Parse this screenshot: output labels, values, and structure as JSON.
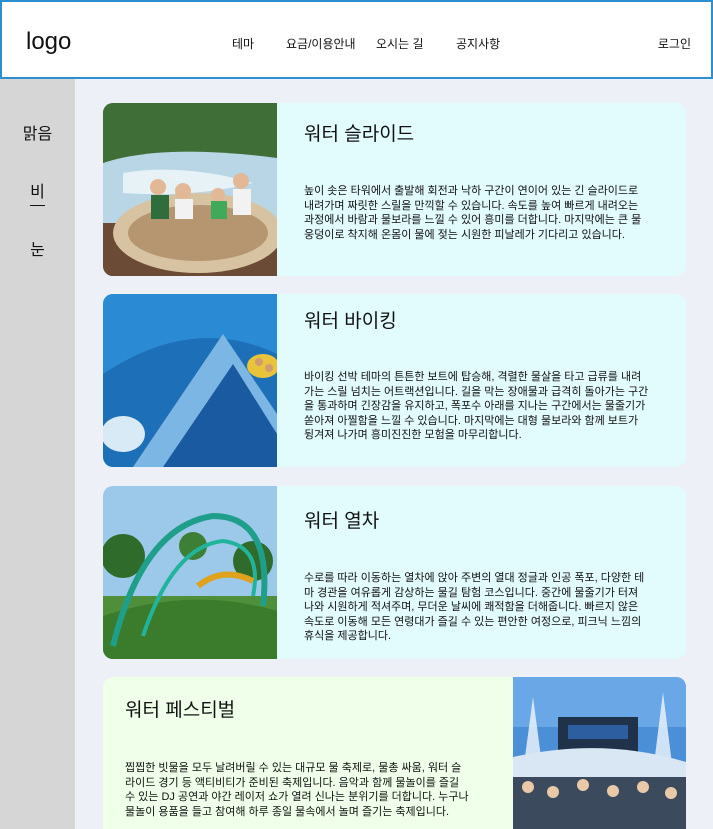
{
  "header": {
    "logo": "logo",
    "nav": [
      "테마",
      "요금/이용안내",
      "오시는 길",
      "공지사항"
    ],
    "login": "로그인"
  },
  "sidebar": {
    "items": [
      "맑음",
      "비",
      "눈"
    ],
    "active": "비"
  },
  "cards": [
    {
      "title": "워터 슬라이드",
      "desc": "높이 솟은 타워에서 출발해 회전과 낙하 구간이 연이어 있는 긴 슬라이드로 내려가며 짜릿한 스릴을 만끽할 수 있습니다. 속도를 높여 빠르게 내려오는 과정에서 바람과 물보라를 느낄 수 있어 흥미를 더합니다. 마지막에는 큰 물웅덩이로 착지해 온몸이 물에 젖는 시원한 피날레가 기다리고 있습니다."
    },
    {
      "title": "워터 바이킹",
      "desc": "바이킹 선박 테마의 튼튼한 보트에 탑승해, 격렬한 물살을 타고 급류를 내려가는 스릴 넘치는 어트랙션입니다. 길을 막는 장애물과 급격히 돌아가는 구간을 통과하며 긴장감을 유지하고, 폭포수 아래를 지나는 구간에서는 물줄기가 쏟아져 아찔함을 느낄 수 있습니다. 마지막에는 대형 물보라와 함께 보트가 뒹겨져 나가며 흥미진진한 모험을 마무리합니다."
    },
    {
      "title": "워터 열차",
      "desc": "수로를 따라 이동하는 열차에 앉아 주변의 열대 정글과 인공 폭포, 다양한 테마 경관을 여유롭게 감상하는 물길 탐험 코스입니다. 중간에 물줄기가 터져 나와 시원하게 적셔주며, 무더운 날씨에 쾌적함을 더해줍니다. 빠르지 않은 속도로 이동해 모든 연령대가 즐길 수 있는 편안한 여정으로, 피크닉 느낌의 휴식을 제공합니다."
    },
    {
      "title": "워터 페스티벌",
      "desc": "찝찝한 빗물을 모두 날려버릴 수 있는 대규모 물 축제로, 물총 싸움, 워터 슬라이드 경기 등 액티비티가 준비된 축제입니다. 음악과 함께 물놀이를 즐길 수 있는 DJ 공연과 야간 레이저 쇼가 열려 신나는 분위기를 더합니다. 누구나 물놀이 용품을 들고 참여해 하루 종일 물속에서 놀며 즐기는 축제입니다."
    }
  ],
  "icons": [
    "water-slide-photo",
    "water-viking-photo",
    "water-train-photo",
    "water-festival-photo"
  ]
}
